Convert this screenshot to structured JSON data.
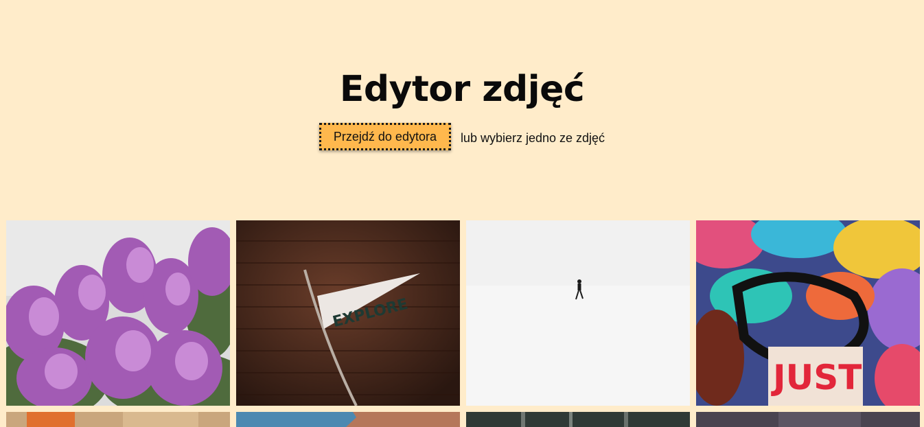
{
  "hero": {
    "title": "Edytor zdjęć",
    "editor_button_label": "Przejdź do edytora",
    "hint": "lub wybierz jedno ze zdjęć"
  },
  "gallery": {
    "photos": [
      {
        "subject": "lilac-flowers"
      },
      {
        "subject": "explore-pennant",
        "text": "EXPLORE"
      },
      {
        "subject": "person-in-snow"
      },
      {
        "subject": "graffiti-wall",
        "text": "JUST"
      },
      {
        "subject": "blurred-orange"
      },
      {
        "subject": "blue-sky-building"
      },
      {
        "subject": "dark-forest"
      },
      {
        "subject": "dark-purple"
      }
    ]
  },
  "colors": {
    "background": "#ffecca",
    "button": "#ffb84d",
    "text": "#111111"
  }
}
